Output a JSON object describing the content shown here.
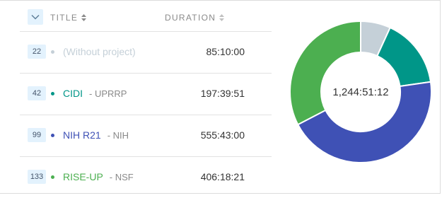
{
  "table": {
    "columns": {
      "title": "TITLE",
      "duration": "DURATION"
    },
    "rows": [
      {
        "count": "22",
        "name": "(Without project)",
        "client": "",
        "duration": "85:10:00",
        "color": "#c5d0d8",
        "name_color": "#c5d0d8"
      },
      {
        "count": "42",
        "name": "CIDI",
        "client": "- UPRRP",
        "duration": "197:39:51",
        "color": "#009688",
        "name_color": "#009688"
      },
      {
        "count": "99",
        "name": "NIH R21",
        "client": "- NIH",
        "duration": "555:43:00",
        "color": "#3f51b5",
        "name_color": "#3f51b5"
      },
      {
        "count": "133",
        "name": "RISE-UP",
        "client": "- NSF",
        "duration": "406:18:21",
        "color": "#4caf50",
        "name_color": "#4caf50"
      }
    ]
  },
  "chart_data": {
    "type": "pie",
    "donut": true,
    "center_label": "1,244:51:12",
    "slices": [
      {
        "label": "(Without project)",
        "value": 85.1667,
        "color": "#c5d0d8"
      },
      {
        "label": "CIDI",
        "value": 197.6642,
        "color": "#009688"
      },
      {
        "label": "NIH R21",
        "value": 555.7167,
        "color": "#3f51b5"
      },
      {
        "label": "RISE-UP",
        "value": 406.3058,
        "color": "#4caf50"
      }
    ]
  },
  "icons": {
    "collapse": "chevron-down-icon",
    "sort": "sort-icon"
  }
}
